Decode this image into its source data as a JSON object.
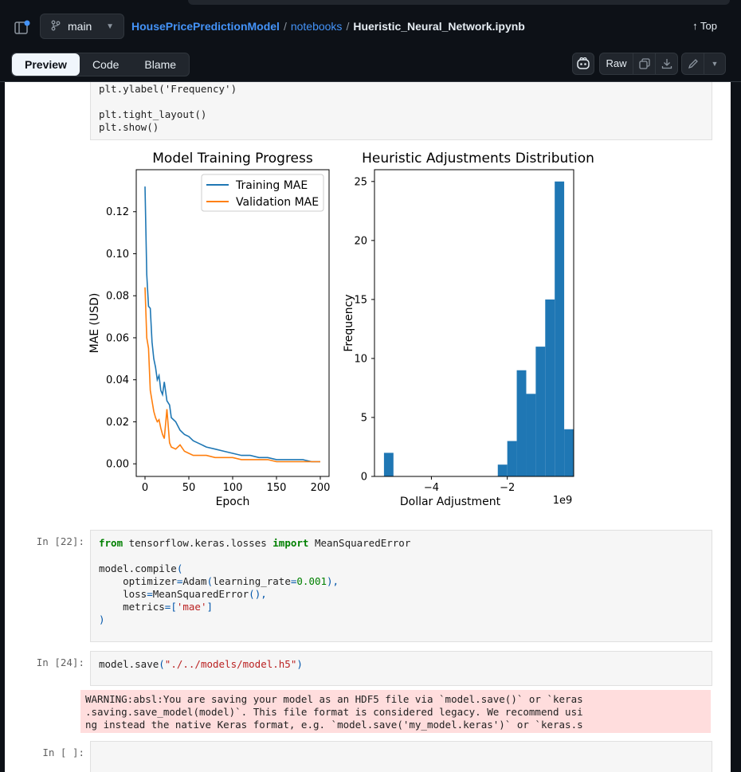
{
  "header": {
    "branch": "main",
    "breadcrumb": {
      "repo": "HousePricePredictionModel",
      "folder": "notebooks",
      "file": "Hueristic_Neural_Network.ipynb"
    },
    "top_label": "Top"
  },
  "toolbar": {
    "tabs": [
      "Preview",
      "Code",
      "Blame"
    ],
    "active_tab": "Preview",
    "raw_label": "Raw",
    "icons": [
      "copilot-icon",
      "copy-icon",
      "download-icon",
      "pencil-icon",
      "chevron-down-icon"
    ]
  },
  "cells": {
    "prev_code": {
      "line1": "plt.ylabel('Frequency')",
      "line3": "plt.tight_layout()",
      "line4": "plt.show()"
    },
    "cell22": {
      "prompt": "In [22]:",
      "line1": "from tensorflow.keras.losses import MeanSquaredError",
      "line3": "model.compile(",
      "line4": "    optimizer=Adam(learning_rate=0.001),",
      "line5": "    loss=MeanSquaredError(),",
      "line6": "    metrics=['mae']",
      "line7": ")"
    },
    "cell24": {
      "prompt": "In [24]:",
      "code": "model.save(\"./../models/model.h5\")",
      "warning": "WARNING:absl:You are saving your model as an HDF5 file via `model.save()` or `keras.saving.save_model(model)`. This file format is considered legacy. We recommend using instead the native Keras format, e.g. `model.save('my_model.keras')` or `keras.saving.save_model(model, 'my_model.keras')`."
    },
    "empty_cell": {
      "prompt": "In [ ]:"
    }
  },
  "colors": {
    "training": "#1f77b4",
    "validation": "#ff7f0e",
    "hist": "#1f77b4"
  },
  "chart_data": [
    {
      "type": "line",
      "title": "Model Training Progress",
      "xlabel": "Epoch",
      "ylabel": "MAE (USD)",
      "xlim": [
        -10,
        210
      ],
      "ylim": [
        -0.006,
        0.14
      ],
      "xticks": [
        0,
        50,
        100,
        150,
        200
      ],
      "yticks": [
        0.0,
        0.02,
        0.04,
        0.06,
        0.08,
        0.1,
        0.12
      ],
      "ytick_labels": [
        "0.00",
        "0.02",
        "0.04",
        "0.06",
        "0.08",
        "0.10",
        "0.12"
      ],
      "legend": "top-right",
      "series": [
        {
          "name": "Training MAE",
          "x": [
            0,
            2,
            4,
            6,
            8,
            10,
            12,
            14,
            16,
            18,
            20,
            22,
            25,
            28,
            30,
            35,
            40,
            45,
            50,
            55,
            60,
            70,
            80,
            90,
            100,
            110,
            120,
            130,
            140,
            150,
            160,
            170,
            180,
            190,
            200
          ],
          "values": [
            0.132,
            0.09,
            0.075,
            0.074,
            0.058,
            0.05,
            0.046,
            0.04,
            0.042,
            0.035,
            0.033,
            0.039,
            0.03,
            0.028,
            0.022,
            0.02,
            0.016,
            0.014,
            0.013,
            0.011,
            0.01,
            0.008,
            0.007,
            0.006,
            0.005,
            0.004,
            0.004,
            0.003,
            0.003,
            0.002,
            0.002,
            0.002,
            0.002,
            0.001,
            0.001
          ]
        },
        {
          "name": "Validation MAE",
          "x": [
            0,
            2,
            4,
            6,
            8,
            10,
            12,
            14,
            16,
            18,
            20,
            22,
            25,
            28,
            30,
            35,
            40,
            45,
            50,
            55,
            60,
            70,
            80,
            90,
            100,
            110,
            120,
            130,
            140,
            150,
            160,
            170,
            180,
            190,
            200
          ],
          "values": [
            0.084,
            0.06,
            0.055,
            0.035,
            0.03,
            0.025,
            0.022,
            0.02,
            0.021,
            0.017,
            0.014,
            0.012,
            0.026,
            0.01,
            0.008,
            0.007,
            0.009,
            0.006,
            0.005,
            0.004,
            0.004,
            0.004,
            0.003,
            0.003,
            0.003,
            0.002,
            0.002,
            0.002,
            0.002,
            0.001,
            0.001,
            0.001,
            0.001,
            0.001,
            0.001
          ]
        }
      ]
    },
    {
      "type": "bar",
      "title": "Heuristic Adjustments Distribution",
      "xlabel": "Dollar Adjustment",
      "ylabel": "Frequency",
      "x_offset_label": "1e9",
      "xlim": [
        -5.5,
        -0.25
      ],
      "ylim": [
        0,
        26
      ],
      "xticks": [
        -4,
        -2
      ],
      "xtick_labels": [
        "−4",
        "−2"
      ],
      "yticks": [
        0,
        5,
        10,
        15,
        20,
        25
      ],
      "bin_width": 0.25,
      "bin_starts": [
        -5.25,
        -2.25,
        -2.0,
        -1.75,
        -1.5,
        -1.25,
        -1.0,
        -0.75,
        -0.5
      ],
      "values": [
        2,
        1,
        3,
        9,
        7,
        11,
        15,
        25,
        4
      ]
    }
  ]
}
